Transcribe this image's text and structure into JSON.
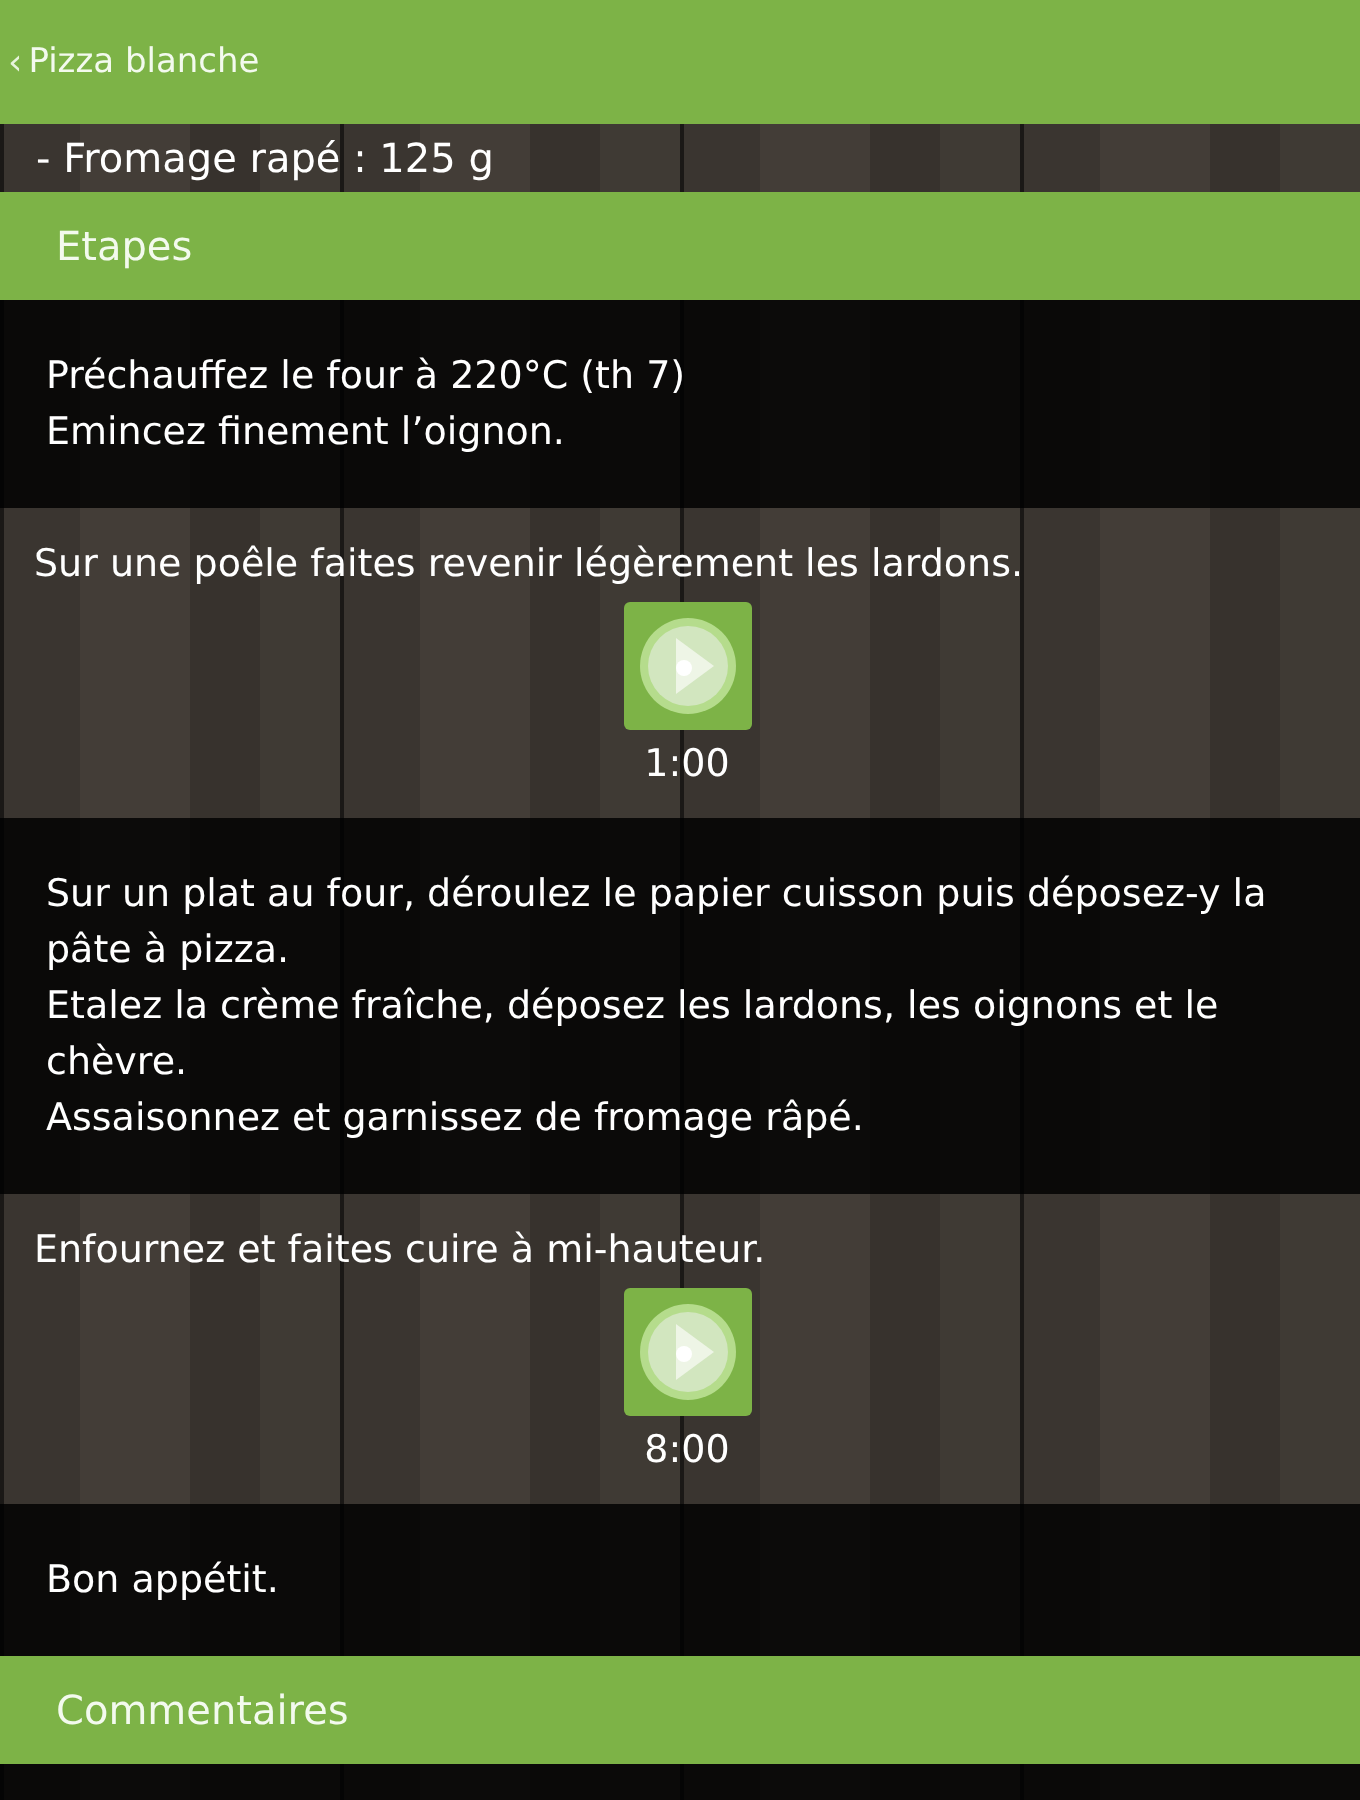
{
  "action_bar": {
    "back": "‹",
    "title": "Pizza blanche"
  },
  "ingredient_partial": "- Fromage rapé : 125 g",
  "sections": [
    {
      "title": "Etapes"
    },
    {
      "title": "Commentaires"
    }
  ],
  "steps": [
    {
      "kind": "text",
      "lines": [
        "Préchauffez le four à 220°C (th 7)",
        "Emincez finement l’oignon."
      ]
    },
    {
      "kind": "timer",
      "lines": [
        "Sur une poêle faites revenir légèrement les lardons."
      ],
      "time": "1:00"
    },
    {
      "kind": "text",
      "lines": [
        "Sur un plat au four, déroulez le papier cuisson puis déposez-y la pâte à pizza.",
        "Etalez la crème fraîche, déposez les lardons, les oignons et le chèvre.",
        "Assaisonnez et garnissez de fromage râpé."
      ]
    },
    {
      "kind": "timer",
      "lines": [
        "Enfournez et faites cuire à mi-hauteur."
      ],
      "time": "8:00"
    },
    {
      "kind": "text",
      "lines": [
        "Bon appétit."
      ]
    }
  ]
}
